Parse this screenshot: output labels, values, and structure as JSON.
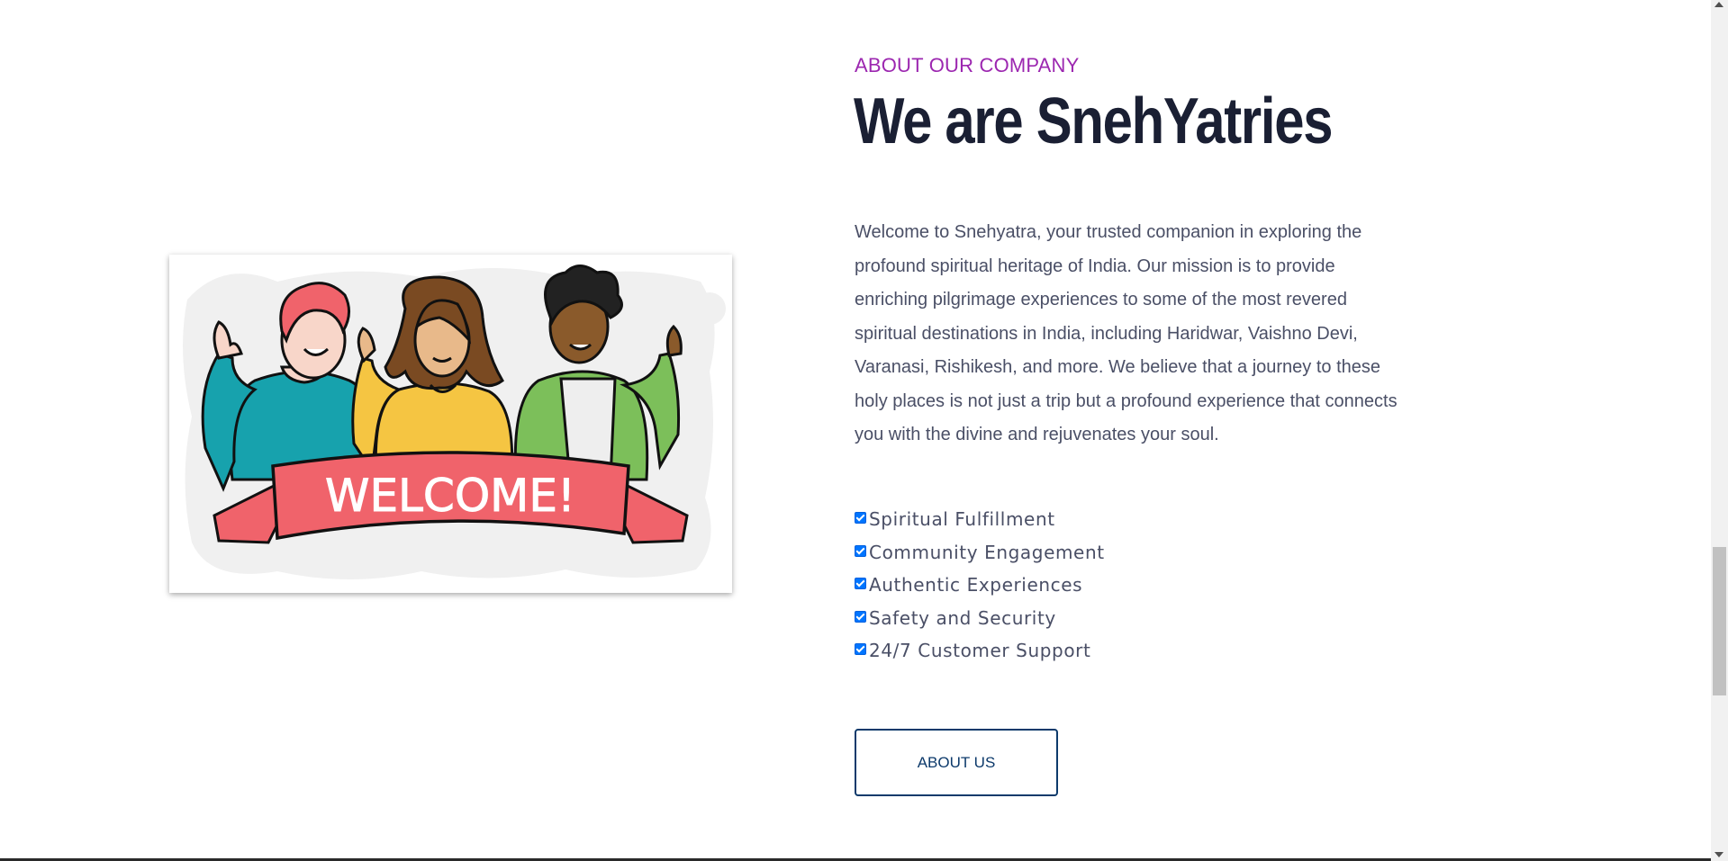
{
  "about": {
    "eyebrow": "ABOUT OUR COMPANY",
    "title": "We are SnehYatries",
    "description": "Welcome to Snehyatra, your trusted companion in exploring the profound spiritual heritage of India. Our mission is to provide enriching pilgrimage experiences to some of the most revered spiritual destinations in India, including Haridwar, Vaishno Devi, Varanasi, Rishikesh, and more. We believe that a journey to these holy places is not just a trip but a profound experience that connects you with the divine and rejuvenates your soul.",
    "features": [
      {
        "label": "Spiritual Fulfillment",
        "checked": true
      },
      {
        "label": "Community Engagement",
        "checked": true
      },
      {
        "label": "Authentic Experiences",
        "checked": true
      },
      {
        "label": "Safety and Security",
        "checked": true
      },
      {
        "label": "24/7 Customer Support",
        "checked": true
      }
    ],
    "button_label": "ABOUT US"
  },
  "illustration": {
    "banner_text": "WELCOME!"
  },
  "colors": {
    "accent": "#9c27b0",
    "title": "#1a1f33",
    "body_text": "#4a4f66",
    "button": "#0d3a6b",
    "banner": "#f0636b"
  }
}
